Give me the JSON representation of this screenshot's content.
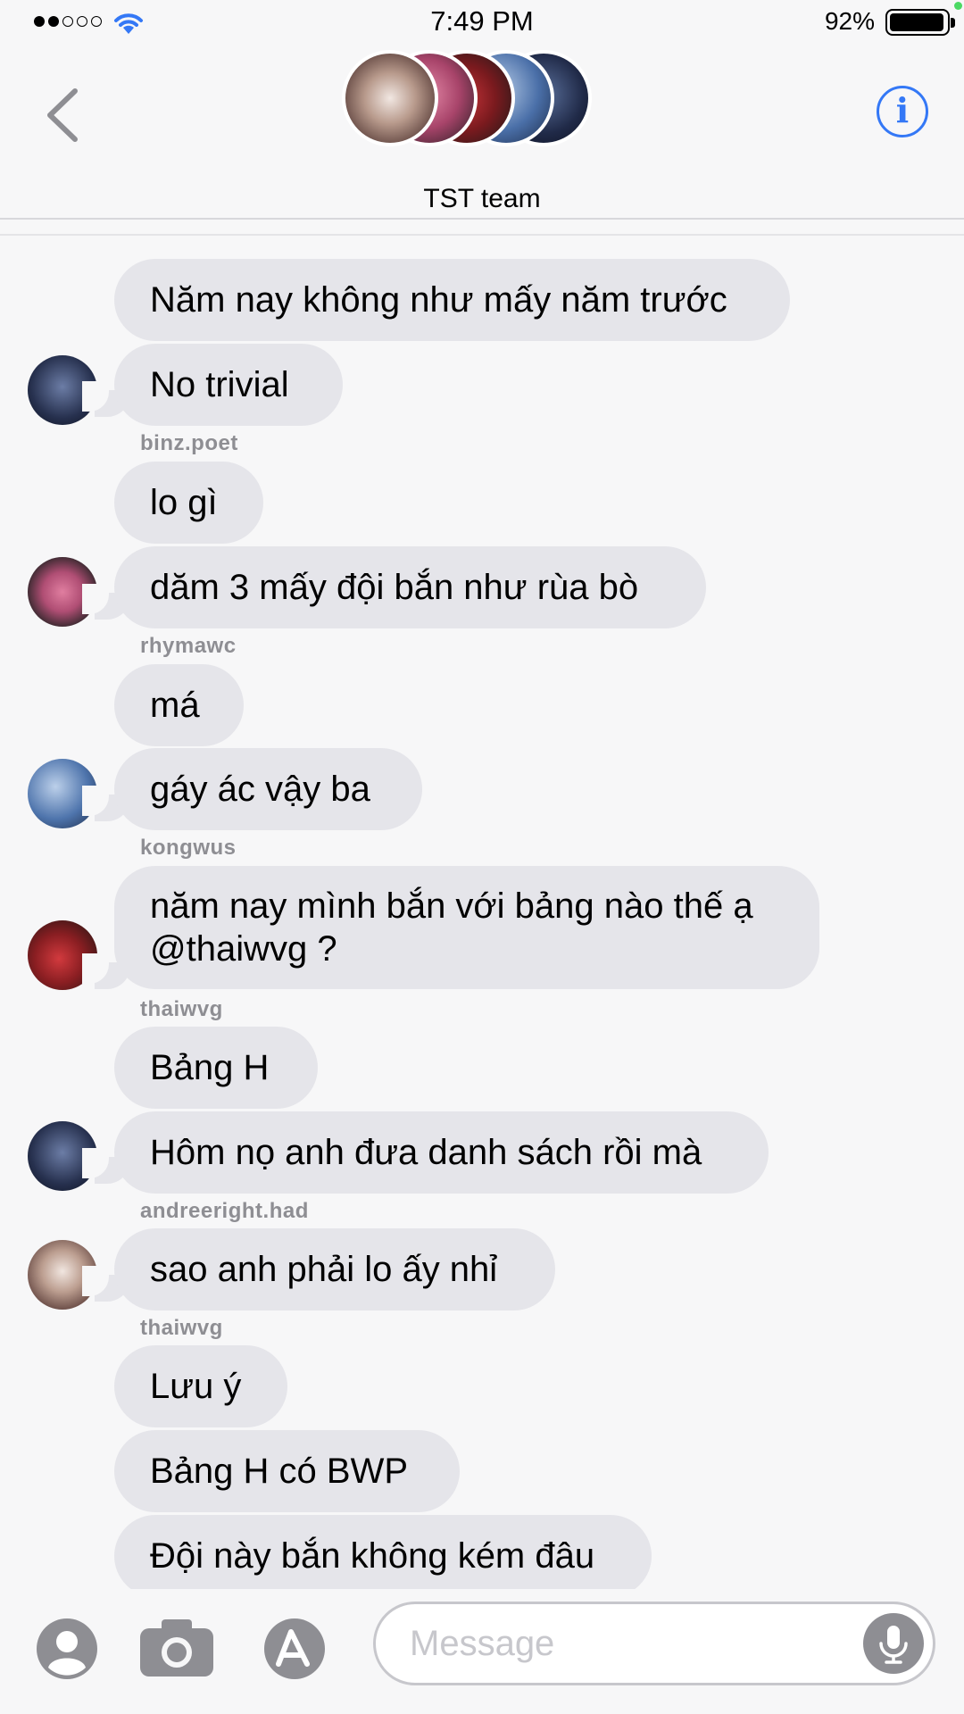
{
  "status": {
    "time": "7:49 PM",
    "battery_pct": "92%",
    "battery_level": 0.92
  },
  "header": {
    "group_name": "TST team"
  },
  "messages": [
    {
      "text": "Năm nay không như mấy năm trước"
    },
    {
      "text": "No trivial"
    },
    {
      "sender": "binz.poet"
    },
    {
      "text": "lo gì"
    },
    {
      "text": "dăm 3 mấy đội bắn như rùa bò"
    },
    {
      "sender": "rhymawc"
    },
    {
      "text": "má"
    },
    {
      "text": "gáy ác vậy ba"
    },
    {
      "sender": "kongwus"
    },
    {
      "text": "năm nay mình bắn với bảng nào thế ạ @thaiwvg ?"
    },
    {
      "sender": "thaiwvg"
    },
    {
      "text": "Bảng H"
    },
    {
      "text": "Hôm nọ anh đưa danh sách rồi mà"
    },
    {
      "sender": "andreeright.had"
    },
    {
      "text": "sao anh phải lo ấy nhỉ"
    },
    {
      "sender": "thaiwvg"
    },
    {
      "text": "Lưu ý"
    },
    {
      "text": "Bảng H có BWP"
    },
    {
      "text": "Đội này bắn không kém đâu"
    }
  ],
  "composer": {
    "placeholder": "Message"
  },
  "colors": {
    "accent": "#3478f6",
    "bubble": "#e5e5ea",
    "sender": "#8e8e93"
  },
  "icons": [
    "back-chevron-icon",
    "info-icon",
    "contact-icon",
    "camera-icon",
    "app-store-icon",
    "mic-icon",
    "wifi-icon"
  ]
}
